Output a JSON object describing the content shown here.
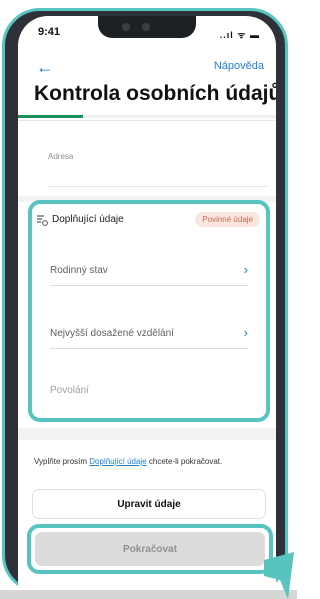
{
  "status": {
    "time": "9:41",
    "icons": "..ıl ᯤ ▬"
  },
  "nav": {
    "back_glyph": "←",
    "help_label": "Nápověda"
  },
  "page": {
    "title": "Kontrola osobních údajů",
    "progress_percent": 25
  },
  "address": {
    "label": "Adresa"
  },
  "section": {
    "title": "Doplňující údaje",
    "badge": "Povinné údaje",
    "fields": [
      {
        "label": "Rodinný stav",
        "chevron": "›"
      },
      {
        "label": "Nejvyšší dosažené vzdělání",
        "chevron": "›"
      },
      {
        "label": "Povolání"
      }
    ]
  },
  "hint": {
    "before": "Vyplňte prosím ",
    "link": "Doplňující údaje",
    "after": " chcete-li pokračovat."
  },
  "buttons": {
    "edit": "Upravit údaje",
    "continue": "Pokračovat"
  },
  "colors": {
    "accent": "#1f80d8",
    "highlight": "#57c4c0",
    "progress": "#1c8f5a",
    "badge_bg": "#fbe6df"
  }
}
